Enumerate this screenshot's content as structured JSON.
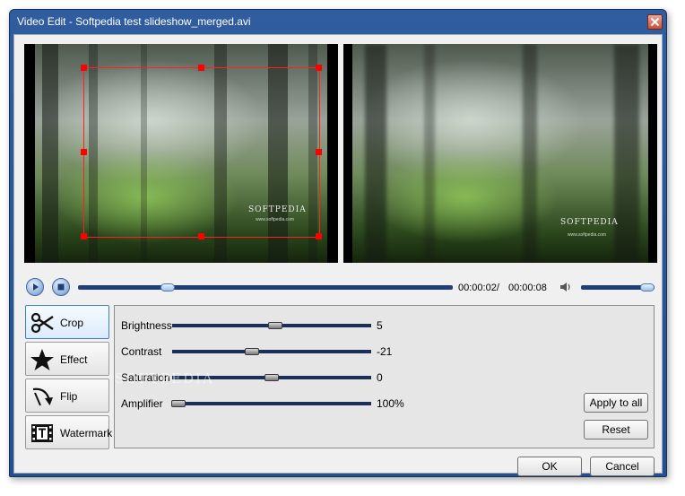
{
  "window": {
    "title": "Video Edit - Softpedia test slideshow_merged.avi"
  },
  "preview": {
    "left_logo": "SOFTPEDIA",
    "left_logo_sub": "www.softpedia.com",
    "right_logo": "SOFTPEDIA",
    "right_logo_sub": "www.softpedia.com"
  },
  "transport": {
    "current_time": "00:00:02/",
    "total_time": "00:00:08",
    "seek_position": 0.24,
    "volume_level": 1.0
  },
  "tools": [
    {
      "label": "Crop",
      "icon": "scissors-icon",
      "active": true
    },
    {
      "label": "Effect",
      "icon": "star-icon",
      "active": false
    },
    {
      "label": "Flip",
      "icon": "flip-arrow-icon",
      "active": false
    },
    {
      "label": "Watermark",
      "icon": "film-text-icon",
      "active": false
    }
  ],
  "adjustments": [
    {
      "label": "Brightness",
      "value": "5",
      "position": 0.52
    },
    {
      "label": "Contrast",
      "value": "-21",
      "position": 0.4
    },
    {
      "label": "Saturation",
      "value": "0",
      "position": 0.5
    },
    {
      "label": "Amplifier",
      "value": "100%",
      "position": 0.03
    }
  ],
  "panel_watermark": "SOFTPEDIA",
  "buttons": {
    "apply_to_all": "Apply to all",
    "reset": "Reset",
    "ok": "OK",
    "cancel": "Cancel"
  },
  "colors": {
    "crop_handle": "#ff0000",
    "title_bar": "#2f5d9f",
    "track": "#1f3f7a"
  }
}
